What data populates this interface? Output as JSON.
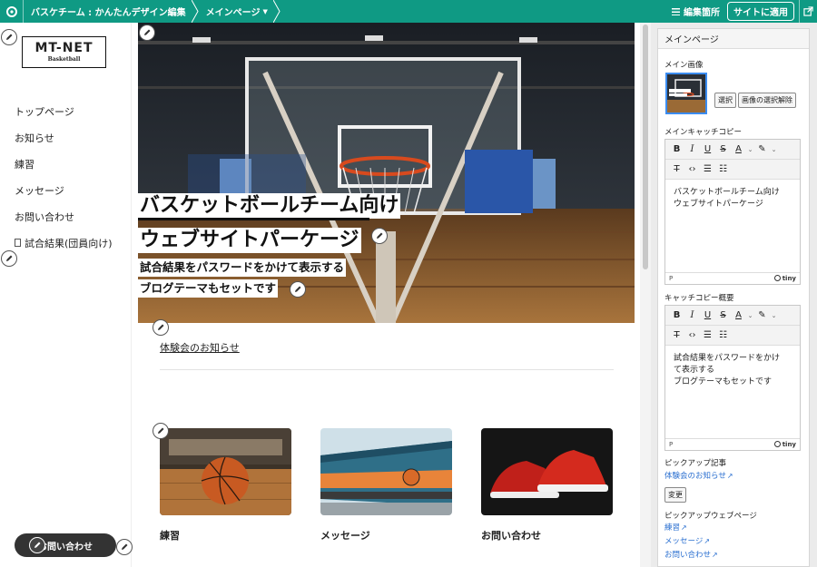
{
  "topbar": {
    "crumb_site": "バスケチーム : かんたんデザイン編集",
    "crumb_page": "メインページ",
    "edit_list_label": "編集箇所",
    "apply_label": "サイトに適用"
  },
  "sidebar": {
    "logo_main": "MT-NET",
    "logo_sub": "Basketball",
    "nav": [
      "トップページ",
      "お知らせ",
      "練習",
      "メッセージ",
      "お問い合わせ",
      "試合結果(団員向け)"
    ],
    "contact_button": "お問い合わせ"
  },
  "main": {
    "hero_line1": "バスケットボールチーム向け",
    "hero_line2": "ウェブサイトパーケージ",
    "hero_sub1": "試合結果をパスワードをかけて表示する",
    "hero_sub2": "ブログテーマもセットです",
    "news_link": "体験会のお知らせ",
    "cards": [
      {
        "label": "練習"
      },
      {
        "label": "メッセージ"
      },
      {
        "label": "お問い合わせ"
      }
    ]
  },
  "panel": {
    "title": "メインページ",
    "main_image_label": "メイン画像",
    "select_btn": "選択",
    "clear_btn": "画像の選択解除",
    "catch_label": "メインキャッチコピー",
    "catch_text_1": "バスケットボールチーム向け",
    "catch_text_2": "ウェブサイトパーケージ",
    "summary_label": "キャッチコピー概要",
    "summary_text_1": "試合結果をパスワードをかけ",
    "summary_text_2": "て表示する",
    "summary_text_3": "ブログテーマもセットです",
    "editor_path": "P",
    "tiny_label": "tiny",
    "pickup_article_label": "ピックアップ記事",
    "pickup_article_link": "体験会のお知らせ",
    "change_btn": "変更",
    "pickup_pages_label": "ピックアップウェブページ",
    "pickup_pages": [
      "練習",
      "メッセージ",
      "お問い合わせ"
    ]
  },
  "colors": {
    "topbar": "#0f9a84",
    "link": "#2a6fd0",
    "selection": "#3b8cf0"
  }
}
